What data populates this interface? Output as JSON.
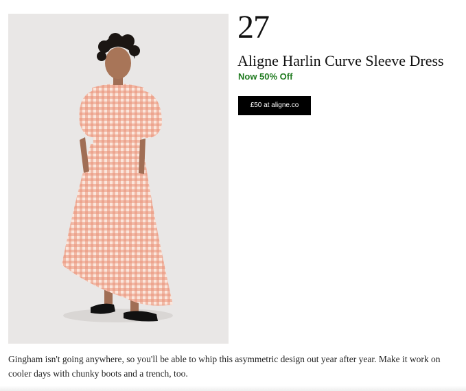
{
  "product": {
    "rank": "27",
    "title": "Aligne Harlin Curve Sleeve Dress",
    "discount": "Now 50% Off",
    "buy_button_label": "£50 at aligne.co",
    "image_alt": "Model wearing an orange gingham dress with puff sleeves and black flats",
    "description": "Gingham isn't going anywhere, so you'll be able to whip this asymmetric design out year after year. Make it work on cooler days with chunky boots and a trench, too."
  },
  "colors": {
    "discount": "#1e7a1e",
    "button_bg": "#000000",
    "button_text": "#ffffff",
    "image_bg": "#e9e7e6",
    "dress_base": "#fbe6dc",
    "gingham": "#e99479"
  }
}
